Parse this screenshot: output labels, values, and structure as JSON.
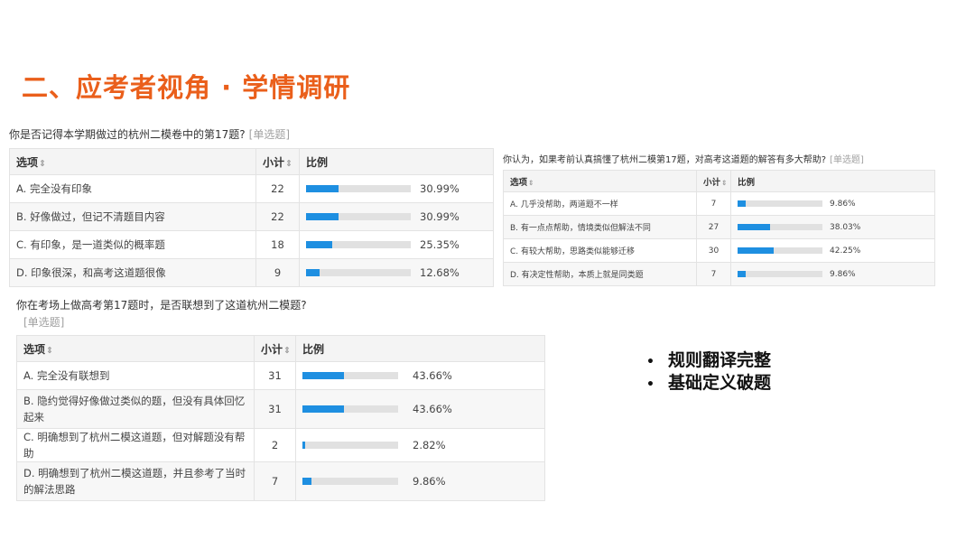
{
  "title": "二、应考者视角 · 学情调研",
  "headers": {
    "option": "选项",
    "count": "小计",
    "ratio": "比例",
    "sort_glyph": "⇕"
  },
  "survey1": {
    "question": "你是否记得本学期做过的杭州二模卷中的第17题?",
    "tag": "[单选题]",
    "rows": [
      {
        "option": "A. 完全没有印象",
        "count": "22",
        "percent": "30.99%",
        "fraction": 0.3099
      },
      {
        "option": "B. 好像做过，但记不清题目内容",
        "count": "22",
        "percent": "30.99%",
        "fraction": 0.3099
      },
      {
        "option": "C. 有印象，是一道类似的概率题",
        "count": "18",
        "percent": "25.35%",
        "fraction": 0.2535
      },
      {
        "option": "D. 印象很深，和高考这道题很像",
        "count": "9",
        "percent": "12.68%",
        "fraction": 0.1268
      }
    ]
  },
  "survey2": {
    "question": "你认为，如果考前认真搞懂了杭州二模第17题，对高考这道题的解答有多大帮助?",
    "tag": "[单选题]",
    "rows": [
      {
        "option": "A. 几乎没帮助，两道题不一样",
        "count": "7",
        "percent": "9.86%",
        "fraction": 0.0986
      },
      {
        "option": "B. 有一点点帮助，情境类似但解法不同",
        "count": "27",
        "percent": "38.03%",
        "fraction": 0.3803
      },
      {
        "option": "C. 有较大帮助，思路类似能够迁移",
        "count": "30",
        "percent": "42.25%",
        "fraction": 0.4225
      },
      {
        "option": "D. 有决定性帮助，本质上就是同类题",
        "count": "7",
        "percent": "9.86%",
        "fraction": 0.0986
      }
    ]
  },
  "survey3": {
    "question": "你在考场上做高考第17题时，是否联想到了这道杭州二模题?",
    "tag": "[单选题]",
    "rows": [
      {
        "option": "A. 完全没有联想到",
        "count": "31",
        "percent": "43.66%",
        "fraction": 0.4366
      },
      {
        "option": "B. 隐约觉得好像做过类似的题，但没有具体回忆起来",
        "count": "31",
        "percent": "43.66%",
        "fraction": 0.4366
      },
      {
        "option": "C. 明确想到了杭州二模这道题，但对解题没有帮助",
        "count": "2",
        "percent": "2.82%",
        "fraction": 0.0282
      },
      {
        "option": "D. 明确想到了杭州二模这道题，并且参考了当时的解法思路",
        "count": "7",
        "percent": "9.86%",
        "fraction": 0.0986
      }
    ]
  },
  "bullets": [
    "规则翻译完整",
    "基础定义破题"
  ],
  "colors": {
    "title": "#ea5f1b",
    "bar": "#1e8fe1",
    "track": "#e1e1e1"
  }
}
